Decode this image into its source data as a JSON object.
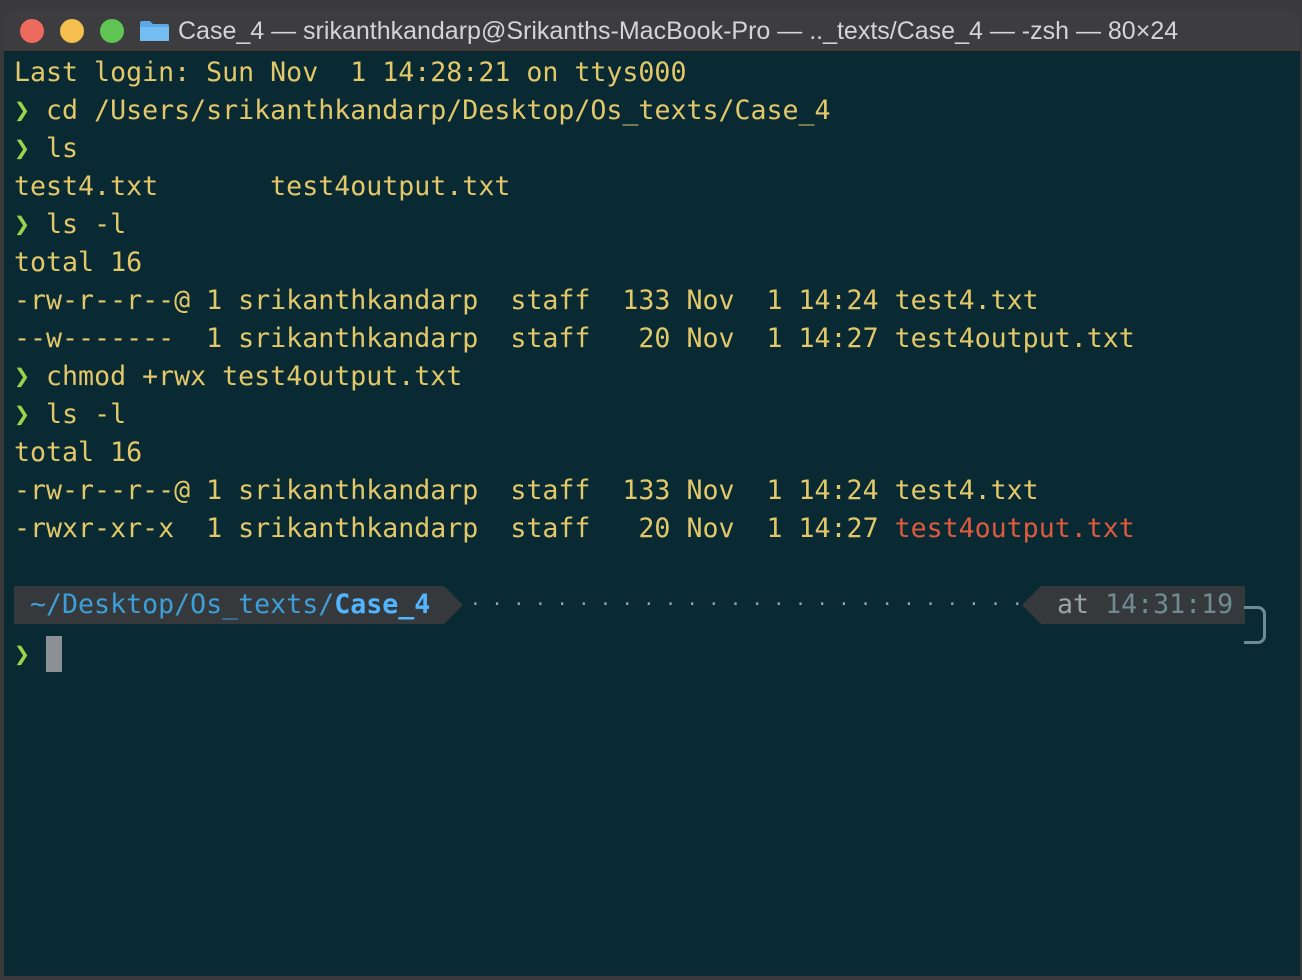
{
  "window": {
    "title": "Case_4 — srikanthkandarp@Srikanths-MacBook-Pro — .._texts/Case_4 — -zsh — 80×24"
  },
  "terminal": {
    "prompt_symbol": "❯",
    "lines": {
      "l0": "Last login: Sun Nov  1 14:28:21 on ttys000",
      "l1": "cd /Users/srikanthkandarp/Desktop/Os_texts/Case_4",
      "l2": "ls",
      "l3": "test4.txt       test4output.txt",
      "l4": "ls -l",
      "l5": "total 16",
      "l6": "-rw-r--r--@ 1 srikanthkandarp  staff  133 Nov  1 14:24 test4.txt",
      "l7": "--w-------  1 srikanthkandarp  staff   20 Nov  1 14:27 test4output.txt",
      "l8": "chmod +rwx test4output.txt",
      "l9": "ls -l",
      "l10": "total 16",
      "l11": "-rw-r--r--@ 1 srikanthkandarp  staff  133 Nov  1 14:24 test4.txt",
      "l12_prefix": "-rwxr-xr-x  1 srikanthkandarp  staff   20 Nov  1 14:27 ",
      "l12_file": "test4output.txt"
    },
    "status": {
      "path_prefix": "~/Desktop/Os_texts/",
      "path_current": "Case_4",
      "at_label": "at",
      "time": "14:31:19"
    }
  },
  "colors": {
    "background": "#0a2a33",
    "text": "#e3c86a",
    "prompt": "#9ad44a",
    "executable_file": "#de5a3f",
    "path": "#3d9fd9"
  }
}
